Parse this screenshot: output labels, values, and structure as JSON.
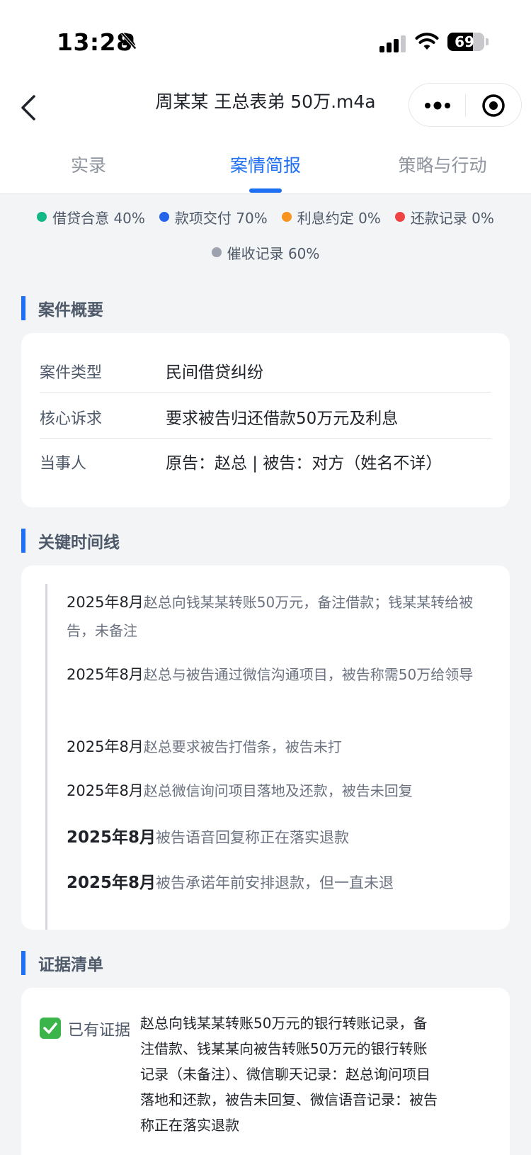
{
  "status": {
    "time": "13:28",
    "battery_level": "69",
    "icons": [
      "bell-slash-icon",
      "signal-icon",
      "wifi-icon",
      "battery-icon"
    ]
  },
  "header": {
    "title": "周某某 王总表弟 50万.m4a",
    "icons": [
      "back-icon",
      "more-icon",
      "target-icon"
    ]
  },
  "tabs": [
    {
      "label": "实录",
      "active": false
    },
    {
      "label": "案情简报",
      "active": true
    },
    {
      "label": "策略与行动",
      "active": false
    }
  ],
  "legend": [
    {
      "label": "借贷合意 40%",
      "color": "#12b886"
    },
    {
      "label": "款项交付 70%",
      "color": "#2563eb"
    },
    {
      "label": "利息约定 0%",
      "color": "#f7931e"
    },
    {
      "label": "还款记录 0%",
      "color": "#ef4444"
    },
    {
      "label": "催收记录 60%",
      "color": "#9ca3af"
    }
  ],
  "overview": {
    "title": "案件概要",
    "rows": [
      {
        "label": "案件类型",
        "value": "民间借贷纠纷"
      },
      {
        "label": "核心诉求",
        "value": "要求被告归还借款50万元及利息"
      },
      {
        "label": "当事人",
        "value": "原告：赵总 | 被告：对方（姓名不详）"
      }
    ]
  },
  "timeline": {
    "title": "关键时间线",
    "items": [
      {
        "date": "2025年8月",
        "text": "赵总向钱某某转账50万元，备注借款；钱某某转给被告，未备注"
      },
      {
        "date": "2025年8月",
        "text": "赵总与被告通过微信沟通项目，被告称需50万给领导"
      },
      {
        "date": "2025年8月",
        "text": "赵总要求被告打借条，被告未打"
      },
      {
        "date": "2025年8月",
        "text": "赵总微信询问项目落地及还款，被告未回复"
      },
      {
        "date": "2025年8月",
        "text": "被告语音回复称正在落实退款"
      },
      {
        "date": "2025年8月",
        "text": "被告承诺年前安排退款，但一直未退"
      }
    ]
  },
  "evidence": {
    "title": "证据清单",
    "label": "已有证据",
    "text": "赵总向钱某某转账50万元的银行转账记录，备注借款、钱某某向被告转账50万元的银行转账记录（未备注）、微信聊天记录：赵总询问项目落地和还款，被告未回复、微信语音记录：被告称正在落实退款"
  },
  "colors": {
    "accent": "#1f6ff2",
    "page_bg": "#f3f4f6",
    "check_green": "#3bb54a"
  }
}
